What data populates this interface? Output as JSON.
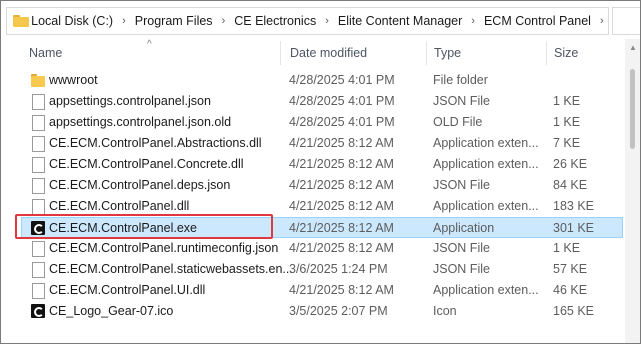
{
  "breadcrumb": {
    "chevrons": "«",
    "items": [
      "Local Disk (C:)",
      "Program Files",
      "CE Electronics",
      "Elite Content Manager",
      "ECM Control Panel"
    ]
  },
  "columns": {
    "name": "Name",
    "date": "Date modified",
    "type": "Type",
    "size": "Size",
    "sort_indicator": "^"
  },
  "files": [
    {
      "name": "wwwroot",
      "date": "4/28/2025 4:01 PM",
      "type": "File folder",
      "size": "",
      "icon": "folder-icon"
    },
    {
      "name": "appsettings.controlpanel.json",
      "date": "4/28/2025 4:01 PM",
      "type": "JSON File",
      "size": "1 KE",
      "icon": "file-icon"
    },
    {
      "name": "appsettings.controlpanel.json.old",
      "date": "4/28/2025 4:01 PM",
      "type": "OLD File",
      "size": "1 KE",
      "icon": "file-icon"
    },
    {
      "name": "CE.ECM.ControlPanel.Abstractions.dll",
      "date": "4/21/2025 8:12 AM",
      "type": "Application exten...",
      "size": "7 KE",
      "icon": "file-icon"
    },
    {
      "name": "CE.ECM.ControlPanel.Concrete.dll",
      "date": "4/21/2025 8:12 AM",
      "type": "Application exten...",
      "size": "26 KE",
      "icon": "file-icon"
    },
    {
      "name": "CE.ECM.ControlPanel.deps.json",
      "date": "4/21/2025 8:12 AM",
      "type": "JSON File",
      "size": "84 KE",
      "icon": "file-icon"
    },
    {
      "name": "CE.ECM.ControlPanel.dll",
      "date": "4/21/2025 8:12 AM",
      "type": "Application exten...",
      "size": "183 KE",
      "icon": "file-icon"
    },
    {
      "name": "CE.ECM.ControlPanel.exe",
      "date": "4/21/2025 8:12 AM",
      "type": "Application",
      "size": "301 KE",
      "icon": "app-icon",
      "selected": true
    },
    {
      "name": "CE.ECM.ControlPanel.runtimeconfig.json",
      "date": "4/21/2025 8:12 AM",
      "type": "JSON File",
      "size": "1 KE",
      "icon": "file-icon"
    },
    {
      "name": "CE.ECM.ControlPanel.staticwebassets.en...",
      "date": "3/6/2025 1:24 PM",
      "type": "JSON File",
      "size": "57 KE",
      "icon": "file-icon"
    },
    {
      "name": "CE.ECM.ControlPanel.UI.dll",
      "date": "4/21/2025 8:12 AM",
      "type": "Application exten...",
      "size": "46 KE",
      "icon": "file-icon"
    },
    {
      "name": "CE_Logo_Gear-07.ico",
      "date": "3/5/2025 2:07 PM",
      "type": "Icon",
      "size": "165 KE",
      "icon": "app-icon"
    }
  ],
  "colors": {
    "selection": "#cce8ff",
    "highlight_border": "#e0383e",
    "folder": "#f7c94f"
  }
}
